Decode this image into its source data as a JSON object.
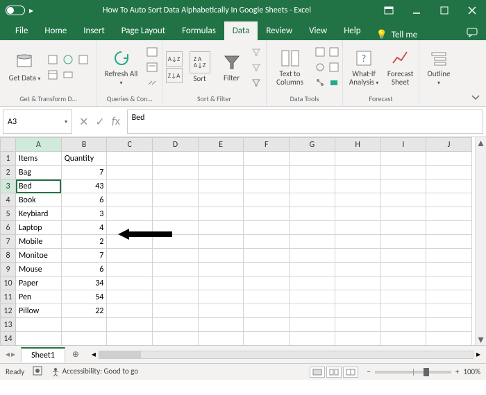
{
  "title": "How To Auto Sort Data Alphabetically In Google Sheets  -  Excel",
  "tabs": [
    "File",
    "Home",
    "Insert",
    "Page Layout",
    "Formulas",
    "Data",
    "Review",
    "View",
    "Help"
  ],
  "active_tab": "Data",
  "tellme": "Tell me",
  "ribbon": {
    "get_data": "Get Data",
    "g1": "Get & Transform D…",
    "refresh": "Refresh All",
    "g2": "Queries & Con…",
    "sort": "Sort",
    "filter": "Filter",
    "g3": "Sort & Filter",
    "text_cols": "Text to Columns",
    "g4": "Data Tools",
    "whatif": "What-If Analysis",
    "forecast_sheet": "Forecast Sheet",
    "g5": "Forecast",
    "outline": "Outline"
  },
  "namebox": "A3",
  "formula": "Bed",
  "columns": [
    "A",
    "B",
    "C",
    "D",
    "E",
    "F",
    "G",
    "H",
    "I",
    "J"
  ],
  "rows": [
    {
      "n": "1",
      "a": "Items",
      "b": "Quantity"
    },
    {
      "n": "2",
      "a": "Bag",
      "b": "7"
    },
    {
      "n": "3",
      "a": "Bed",
      "b": "43"
    },
    {
      "n": "4",
      "a": "Book",
      "b": "6"
    },
    {
      "n": "5",
      "a": "Keybiard",
      "b": "3"
    },
    {
      "n": "6",
      "a": "Laptop",
      "b": "4"
    },
    {
      "n": "7",
      "a": "Mobile",
      "b": "2"
    },
    {
      "n": "8",
      "a": "Monitoe",
      "b": "7"
    },
    {
      "n": "9",
      "a": "Mouse",
      "b": "6"
    },
    {
      "n": "10",
      "a": "Paper",
      "b": "34"
    },
    {
      "n": "11",
      "a": "Pen",
      "b": "54"
    },
    {
      "n": "12",
      "a": "Pillow",
      "b": "22"
    },
    {
      "n": "13",
      "a": "",
      "b": ""
    },
    {
      "n": "14",
      "a": "",
      "b": ""
    }
  ],
  "active_cell": "A3",
  "sheet_tab": "Sheet1",
  "status": {
    "ready": "Ready",
    "access": "Accessibility: Good to go",
    "zoom": "100%"
  },
  "chart_data": {
    "type": "table",
    "title": "",
    "columns": [
      "Items",
      "Quantity"
    ],
    "records": [
      {
        "Items": "Bag",
        "Quantity": 7
      },
      {
        "Items": "Bed",
        "Quantity": 43
      },
      {
        "Items": "Book",
        "Quantity": 6
      },
      {
        "Items": "Keybiard",
        "Quantity": 3
      },
      {
        "Items": "Laptop",
        "Quantity": 4
      },
      {
        "Items": "Mobile",
        "Quantity": 2
      },
      {
        "Items": "Monitoe",
        "Quantity": 7
      },
      {
        "Items": "Mouse",
        "Quantity": 6
      },
      {
        "Items": "Paper",
        "Quantity": 34
      },
      {
        "Items": "Pen",
        "Quantity": 54
      },
      {
        "Items": "Pillow",
        "Quantity": 22
      }
    ]
  }
}
